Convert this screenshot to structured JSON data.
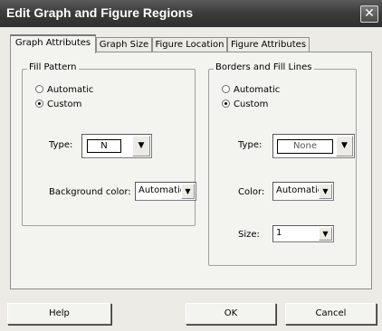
{
  "window": {
    "title": "Edit Graph and Figure Regions",
    "close_glyph": "✕"
  },
  "tabs": [
    {
      "label": "Graph Attributes",
      "active": true
    },
    {
      "label": "Graph Size",
      "active": false
    },
    {
      "label": "Figure Location",
      "active": false
    },
    {
      "label": "Figure Attributes",
      "active": false
    }
  ],
  "fill_pattern": {
    "legend": "Fill Pattern",
    "automatic_label": "Automatic",
    "custom_label": "Custom",
    "selected": "Custom",
    "type_label": "Type:",
    "type_value": "N",
    "background_label": "Background color:",
    "background_value": "Automatic"
  },
  "borders": {
    "legend": "Borders and Fill Lines",
    "automatic_label": "Automatic",
    "custom_label": "Custom",
    "selected": "Custom",
    "type_label": "Type:",
    "type_value": "None",
    "color_label": "Color:",
    "color_value": "Automatic",
    "size_label": "Size:",
    "size_value": "1"
  },
  "buttons": {
    "help": "Help",
    "ok": "OK",
    "cancel": "Cancel"
  },
  "icons": {
    "dropdown": "dropdown-arrow-icon",
    "close": "close-icon"
  }
}
